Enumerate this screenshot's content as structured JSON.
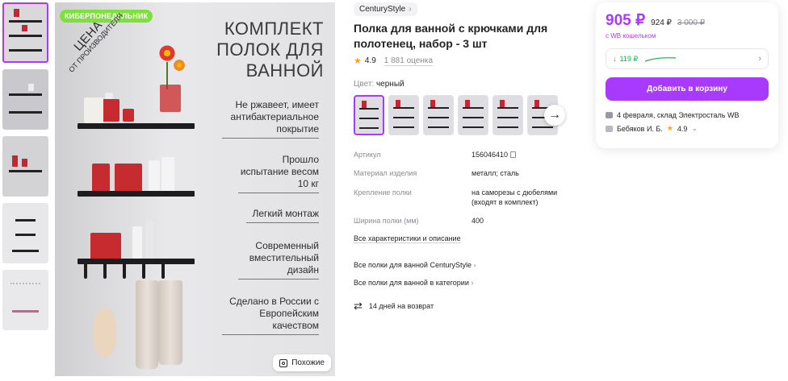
{
  "gallery": {
    "thumbnails": [
      "thumb-1",
      "thumb-2",
      "thumb-3",
      "thumb-4",
      "thumb-5"
    ],
    "promo_badge": "КИБЕРПОНЕДЕЛЬНИК",
    "promo_stamp_top": "ЦЕНА",
    "promo_stamp_bottom": "ОТ ПРОИЗВОДИТЕЛЯ",
    "image_title": "КОМПЛЕКТ ПОЛОК ДЛЯ ВАННОЙ",
    "features": [
      "Не ржавеет, имеет антибактериальное покрытие",
      "Прошло испытание весом 10 кг",
      "Легкий монтаж",
      "Современный вместительный дизайн",
      "Сделано в России с Европейским качеством"
    ],
    "similar_label": "Похожие"
  },
  "product": {
    "brand": "CenturyStyle",
    "title": "Полка для ванной с крючками для полотенец, набор - 3 шт",
    "rating": "4.9",
    "reviews": "1 881 оценка",
    "color_label": "Цвет:",
    "color_value": "черный",
    "variants_count": 6
  },
  "specs": [
    {
      "key": "Артикул",
      "value": "156046410"
    },
    {
      "key": "Материал изделия",
      "value": "металл; сталь"
    },
    {
      "key": "Крепление полки",
      "value": "на саморезы с дюбелями (входят в комплект)"
    },
    {
      "key": "Ширина полки (мм)",
      "value": "400"
    }
  ],
  "links": {
    "all_specs": "Все характеристики и описание",
    "brand_category": "Все полки для ванной CenturyStyle",
    "category": "Все полки для ванной в категории",
    "returns": "14 дней на возврат"
  },
  "price_card": {
    "price": "905 ₽",
    "price_old": "924 ₽",
    "price_crossed": "3 000 ₽",
    "wallet_note": "с WB кошельком",
    "cashback": "119 ₽",
    "cart_button": "Добавить в корзину",
    "delivery": "4 февраля, склад Электросталь WB",
    "seller_name": "Бебяков И. Б.",
    "seller_rating": "4.9",
    "accent_color": "#a73afd",
    "cashback_color": "#12b04a",
    "star_color": "#ff9f24"
  },
  "icons": [
    "chevron-right-icon",
    "arrow-right-icon",
    "copy-icon",
    "return-icon",
    "delivery-icon",
    "seller-icon",
    "star-icon",
    "search-similar-icon",
    "chevron-down-icon"
  ]
}
